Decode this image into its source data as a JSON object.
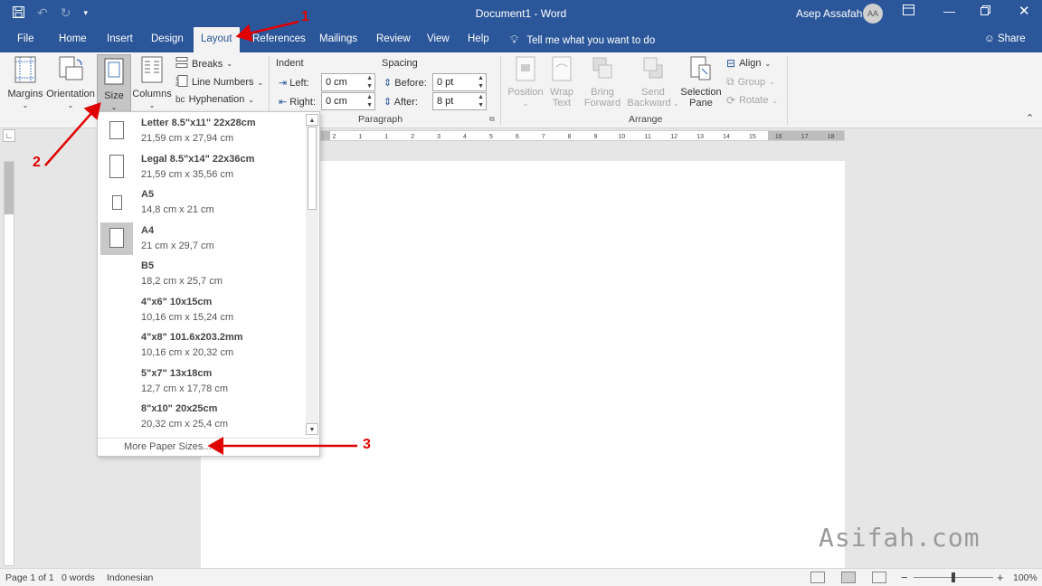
{
  "window": {
    "title": "Document1 - Word",
    "user": "Asep Assafah",
    "avatar_initials": "AA",
    "accent_color": "#2b579a"
  },
  "quick_access": [
    "save-icon",
    "undo-icon",
    "redo-icon",
    "customize-icon"
  ],
  "tabs": [
    "File",
    "Home",
    "Insert",
    "Design",
    "Layout",
    "References",
    "Mailings",
    "Review",
    "View",
    "Help"
  ],
  "active_tab": "Layout",
  "tell_me": "Tell me what you want to do",
  "share": "Share",
  "ribbon": {
    "page_setup": {
      "margins": "Margins",
      "orientation": "Orientation",
      "size": "Size",
      "columns": "Columns",
      "breaks": "Breaks",
      "line_numbers": "Line Numbers",
      "hyphenation": "Hyphenation"
    },
    "paragraph": {
      "group_label": "Paragraph",
      "indent_label": "Indent",
      "spacing_label": "Spacing",
      "left_label": "Left:",
      "left_value": "0 cm",
      "right_label": "Right:",
      "right_value": "0 cm",
      "before_label": "Before:",
      "before_value": "0 pt",
      "after_label": "After:",
      "after_value": "8 pt"
    },
    "arrange": {
      "group_label": "Arrange",
      "position": "Position",
      "wrap_text_1": "Wrap",
      "wrap_text_2": "Text",
      "bring_forward_1": "Bring",
      "bring_forward_2": "Forward",
      "send_backward_1": "Send",
      "send_backward_2": "Backward",
      "selection_pane_1": "Selection",
      "selection_pane_2": "Pane",
      "align": "Align",
      "group": "Group",
      "rotate": "Rotate"
    }
  },
  "size_menu": {
    "items": [
      {
        "name": "Letter 8.5\"x11\" 22x28cm",
        "dims": "21,59 cm x 27,94 cm"
      },
      {
        "name": "Legal 8.5\"x14\" 22x36cm",
        "dims": "21,59 cm x 35,56 cm"
      },
      {
        "name": "A5",
        "dims": "14,8 cm x 21 cm"
      },
      {
        "name": "A4",
        "dims": "21 cm x 29,7 cm"
      },
      {
        "name": "B5",
        "dims": "18,2 cm x 25,7 cm"
      },
      {
        "name": "4\"x6\" 10x15cm",
        "dims": "10,16 cm x 15,24 cm"
      },
      {
        "name": "4\"x8\" 101.6x203.2mm",
        "dims": "10,16 cm x 20,32 cm"
      },
      {
        "name": "5\"x7\" 13x18cm",
        "dims": "12,7 cm x 17,78 cm"
      },
      {
        "name": "8\"x10\" 20x25cm",
        "dims": "20,32 cm x 25,4 cm"
      }
    ],
    "selected": "A4",
    "more": "More Paper Sizes..."
  },
  "annotations": [
    "1",
    "2",
    "3"
  ],
  "annotation_color": "#e00000",
  "ruler_labels": [
    "2",
    "1",
    "1",
    "2",
    "3",
    "4",
    "5",
    "6",
    "7",
    "8",
    "9",
    "10",
    "11",
    "12",
    "13",
    "14",
    "15",
    "16",
    "17",
    "18"
  ],
  "watermark": "Asifah.com",
  "status": {
    "page": "Page 1 of 1",
    "words": "0 words",
    "language": "Indonesian",
    "zoom": "100%",
    "zoom_minus": "−",
    "zoom_plus": "+"
  }
}
